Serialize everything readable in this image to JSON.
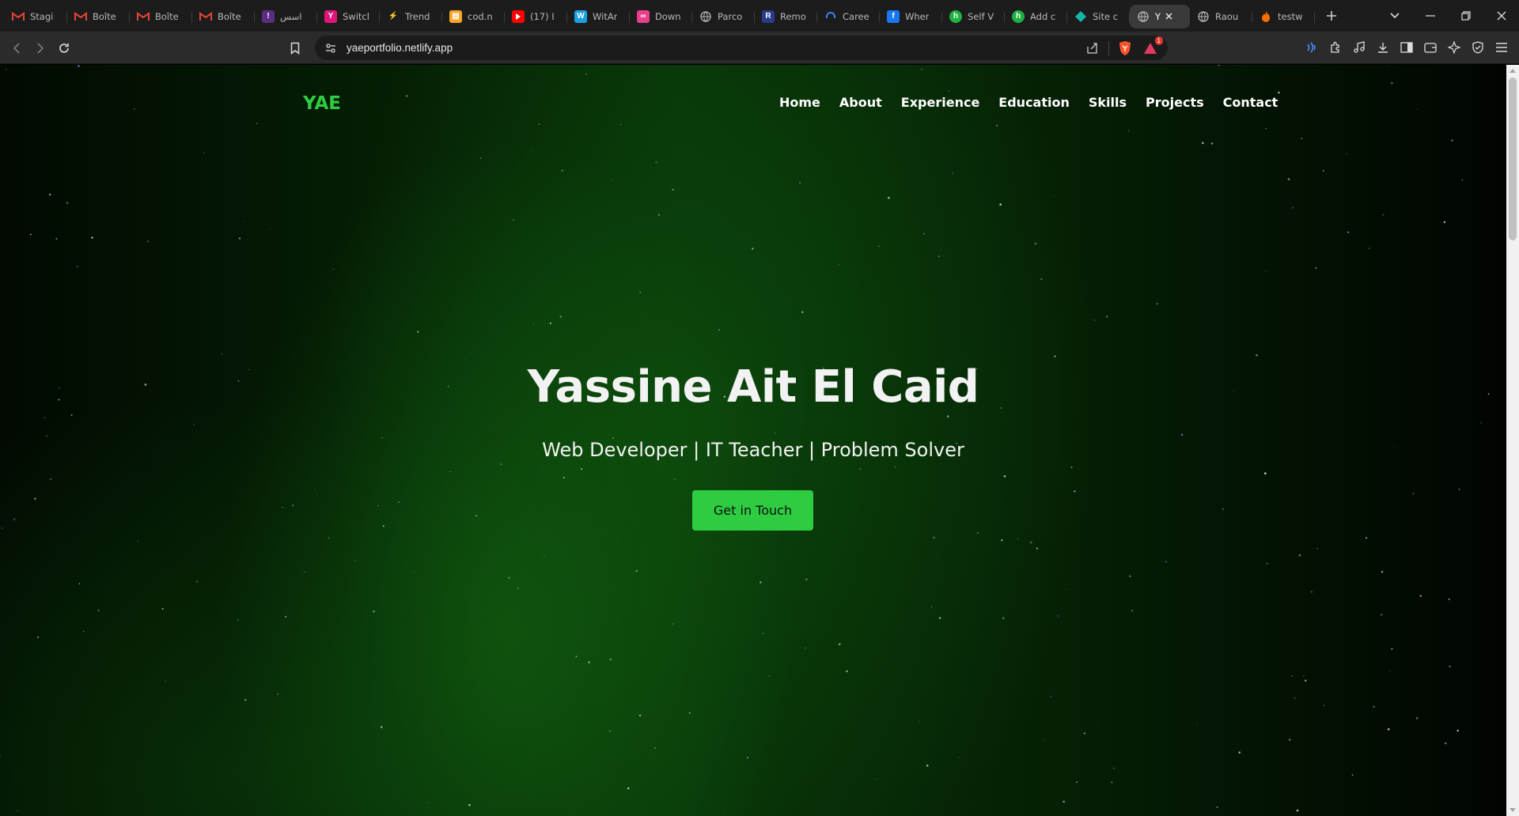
{
  "browser": {
    "tabs": [
      {
        "label": "Stagi",
        "icon": "gmail-icon",
        "color": "#ea4335"
      },
      {
        "label": "Boîte",
        "icon": "gmail-icon",
        "color": "#ea4335"
      },
      {
        "label": "Boîte",
        "icon": "gmail-icon",
        "color": "#ea4335"
      },
      {
        "label": "Boîte",
        "icon": "gmail-icon",
        "color": "#ea4335"
      },
      {
        "label": "اسس",
        "icon": "figure-icon",
        "color": "#5a2d82"
      },
      {
        "label": "Switcl",
        "icon": "yahoo-icon",
        "color": "#e0157a"
      },
      {
        "label": "Trend",
        "icon": "trend-icon",
        "color": "#444444"
      },
      {
        "label": "cod.n",
        "icon": "code-icon",
        "color": "#f5a623"
      },
      {
        "label": "(17) I",
        "icon": "youtube-icon",
        "color": "#ff0000"
      },
      {
        "label": "WitAr",
        "icon": "w-icon",
        "color": "#1ba1e2"
      },
      {
        "label": "Down",
        "icon": "download-site-icon",
        "color": "#e83e8c"
      },
      {
        "label": "Parco",
        "icon": "globe-ring-icon",
        "color": "#dddddd"
      },
      {
        "label": "Remo",
        "icon": "r-icon",
        "color": "#2a3a8c"
      },
      {
        "label": "Caree",
        "icon": "headphones-icon",
        "color": "#3b82f6"
      },
      {
        "label": "Wher",
        "icon": "facebook-icon",
        "color": "#1877f2"
      },
      {
        "label": "Self V",
        "icon": "h-icon",
        "color": "#1fb141"
      },
      {
        "label": "Add c",
        "icon": "h-icon",
        "color": "#1fb141"
      },
      {
        "label": "Site c",
        "icon": "diamond-icon",
        "color": "#15b6a8"
      },
      {
        "label": "Y",
        "icon": "globe-icon",
        "color": "#bbbbbb",
        "active": true
      },
      {
        "label": "Raou",
        "icon": "globe-icon",
        "color": "#bbbbbb"
      },
      {
        "label": "testw",
        "icon": "flame-icon",
        "color": "#ff6d00"
      }
    ],
    "url": "yaeportfolio.netlify.app",
    "brave_rewards_badge": "1"
  },
  "site": {
    "logo": "YAE",
    "nav": [
      "Home",
      "About",
      "Experience",
      "Education",
      "Skills",
      "Projects",
      "Contact"
    ],
    "hero_title": "Yassine Ait El Caid",
    "hero_subtitle": "Web Developer | IT Teacher | Problem Solver",
    "cta_label": "Get in Touch",
    "accent_color": "#2ecc40"
  }
}
